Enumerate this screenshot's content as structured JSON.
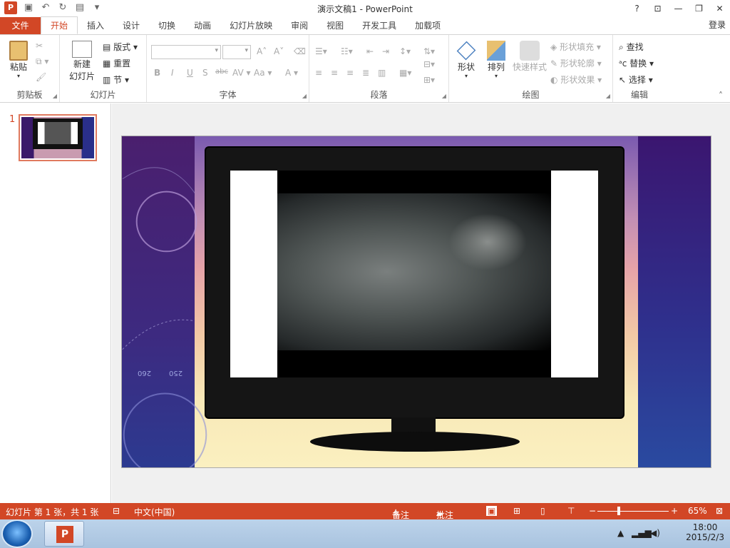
{
  "window": {
    "title": "演示文稿1 - PowerPoint",
    "help": "?",
    "login": "登录"
  },
  "tabs": [
    "文件",
    "开始",
    "插入",
    "设计",
    "切换",
    "动画",
    "幻灯片放映",
    "审阅",
    "视图",
    "开发工具",
    "加载项"
  ],
  "ribbon": {
    "clipboard": {
      "paste": "粘贴",
      "group": "剪贴板"
    },
    "slides": {
      "new_slide_1": "新建",
      "new_slide_2": "幻灯片",
      "layout": "版式",
      "reset": "重置",
      "section": "节",
      "group": "幻灯片"
    },
    "font": {
      "group": "字体",
      "bold": "B",
      "italic": "I",
      "underline": "U",
      "shadow": "S",
      "strike": "abc",
      "spacing": "AV",
      "case": "Aa",
      "grow": "A",
      "shrink": "A",
      "color": "A"
    },
    "paragraph": {
      "group": "段落"
    },
    "drawing": {
      "shape": "形状",
      "arrange": "排列",
      "quick_styles": "快速样式",
      "fill": "形状填充",
      "outline": "形状轮廓",
      "effects": "形状效果",
      "group": "绘图"
    },
    "editing": {
      "find": "查找",
      "replace": "替换",
      "select": "选择",
      "group": "编辑"
    }
  },
  "slide_panel": {
    "number": "1"
  },
  "slide": {
    "tick_a": "260",
    "tick_b": "250"
  },
  "status": {
    "slide_info": "幻灯片 第 1 张，共 1 张",
    "language": "中文(中国)",
    "notes": "备注",
    "comments": "批注",
    "zoom": "65%",
    "zoom_fraction": 0.3
  },
  "taskbar": {
    "time": "18:00",
    "date": "2015/2/3"
  },
  "colors": {
    "accent": "#d24726",
    "taskbar": "#bcd3ea"
  }
}
